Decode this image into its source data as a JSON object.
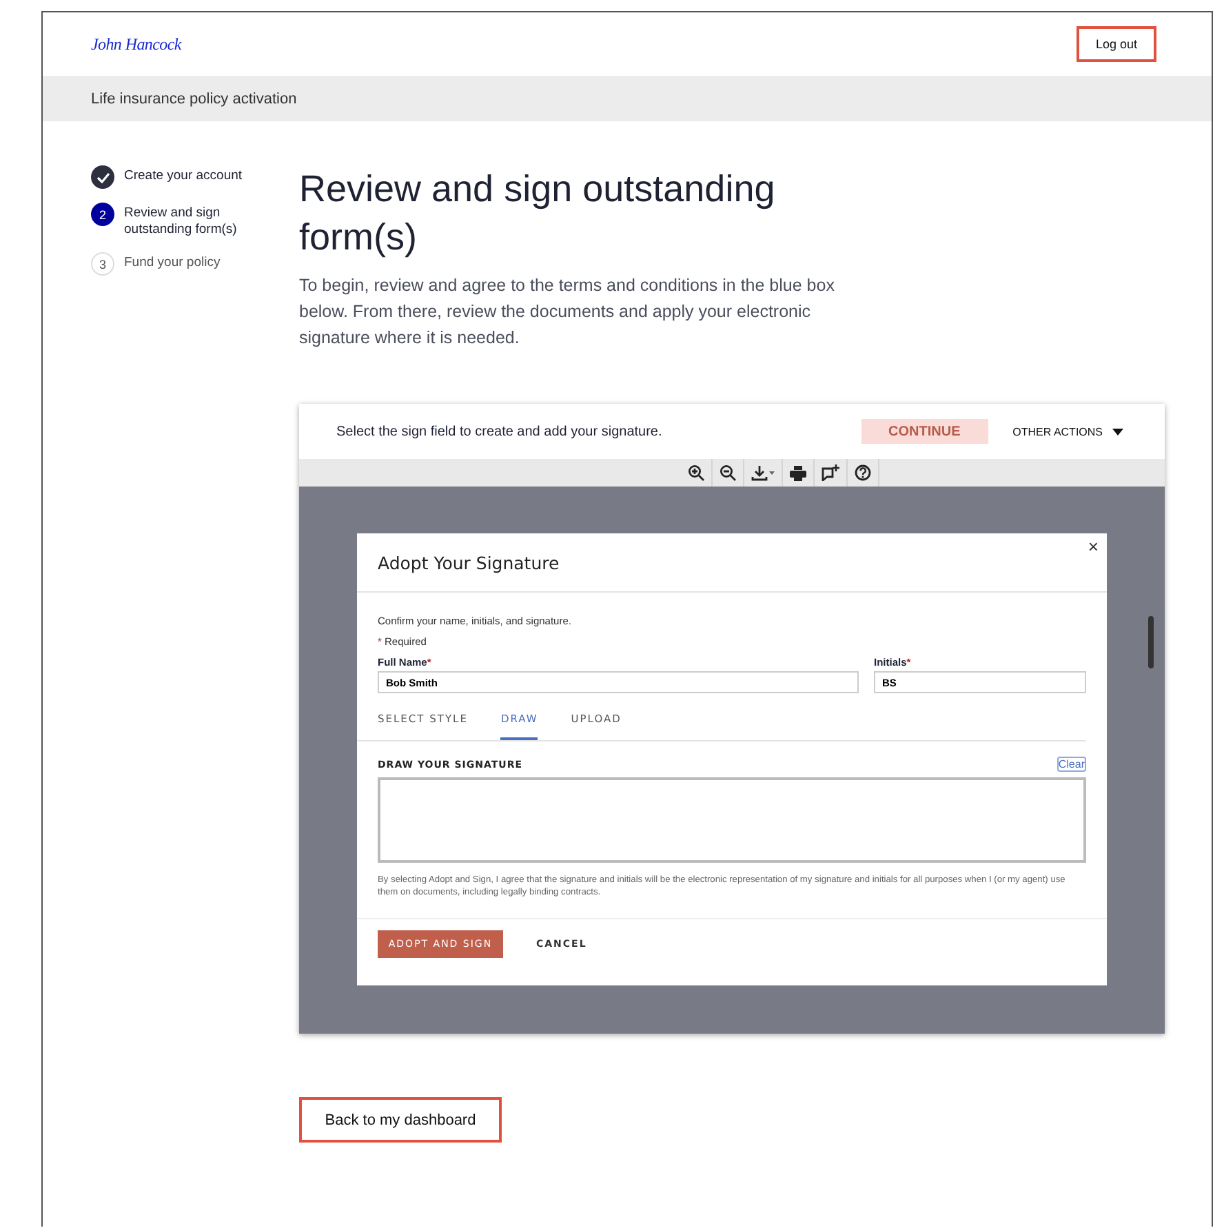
{
  "header": {
    "logo": "John Hancock",
    "logout_button": "Log out"
  },
  "banner": {
    "title": "Life insurance policy activation"
  },
  "steps": [
    {
      "label": "Create your account",
      "completed": true,
      "selected": false
    },
    {
      "number": "2",
      "label": "Review and sign outstanding form(s)",
      "completed": false,
      "selected": true
    },
    {
      "number": "3",
      "label": "Fund your policy",
      "completed": false,
      "selected": false
    }
  ],
  "main": {
    "title": "Review and sign outstanding form(s)",
    "description": "To begin, review and agree to the terms and conditions in the blue box below. From there, review the documents and apply your electronic signature where it is needed."
  },
  "viewer": {
    "instruction": "Select the sign field to create and add your signature.",
    "continue_button": {
      "label": "CONTINUE",
      "disabled": true
    },
    "other_actions": "OTHER ACTIONS",
    "toolbar": [
      {
        "kind": "zoom-in"
      },
      {
        "kind": "zoom-out"
      },
      {
        "kind": "download"
      },
      {
        "kind": "print"
      },
      {
        "kind": "comment"
      },
      {
        "kind": "help"
      }
    ]
  },
  "modal": {
    "title": "Adopt Your Signature",
    "close": "×",
    "intro": "Confirm your name, initials, and signature.",
    "required_mark": "*",
    "required_note": "Required",
    "fields": [
      {
        "label": "Full Name",
        "required_mark": "*",
        "value": "Bob Smith"
      },
      {
        "label": "Initials",
        "required_mark": "*",
        "value": "BS"
      }
    ],
    "tabs": [
      {
        "label": "SELECT STYLE",
        "selected": false
      },
      {
        "label": "DRAW",
        "selected": true
      },
      {
        "label": "UPLOAD",
        "selected": false
      }
    ],
    "draw_label": "DRAW YOUR SIGNATURE",
    "clear_link": "Clear",
    "legal_text": "By selecting Adopt and Sign, I agree that the signature and initials will be the electronic representation of my signature and initials for all purposes when I (or my agent) use them on documents, including legally binding contracts.",
    "adopt_button": "ADOPT AND SIGN",
    "cancel_button": "CANCEL"
  },
  "back_button": "Back to my dashboard"
}
